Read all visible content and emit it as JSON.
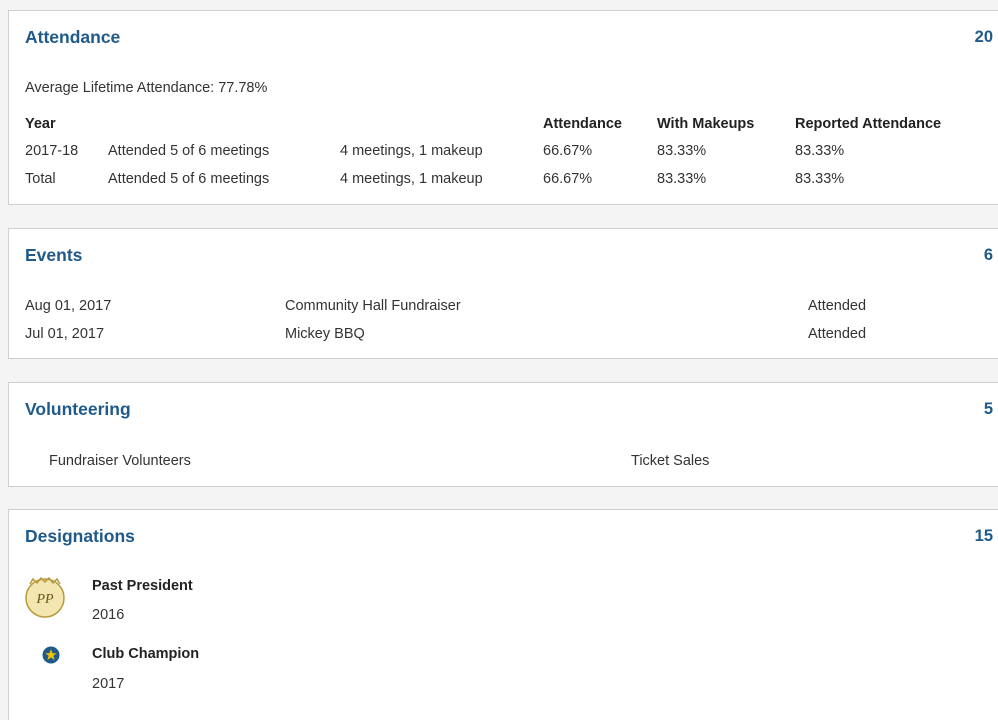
{
  "attendance": {
    "title": "Attendance",
    "count": "20",
    "average": "Average Lifetime Attendance: 77.78%",
    "headers": {
      "year": "Year",
      "attendance": "Attendance",
      "with_makeups": "With Makeups",
      "reported": "Reported Attendance"
    },
    "rows": [
      {
        "year": "2017-18",
        "attended": "Attended 5 of 6 meetings",
        "detail": "4 meetings, 1 makeup",
        "attendance": "66.67%",
        "with_makeups": "83.33%",
        "reported": "83.33%"
      },
      {
        "year": "Total",
        "attended": "Attended 5 of 6 meetings",
        "detail": "4 meetings, 1 makeup",
        "attendance": "66.67%",
        "with_makeups": "83.33%",
        "reported": "83.33%"
      }
    ]
  },
  "events": {
    "title": "Events",
    "count": "6",
    "rows": [
      {
        "date": "Aug 01, 2017",
        "name": "Community Hall Fundraiser",
        "status": "Attended"
      },
      {
        "date": "Jul 01, 2017",
        "name": "Mickey BBQ",
        "status": "Attended"
      }
    ]
  },
  "volunteering": {
    "title": "Volunteering",
    "count": "5",
    "rows": [
      {
        "group": "Fundraiser Volunteers",
        "role": "Ticket Sales"
      }
    ]
  },
  "designations": {
    "title": "Designations",
    "count": "15",
    "items": [
      {
        "name": "Past President",
        "year": "2016",
        "icon": "past-president-badge-icon",
        "badge_text": "PP"
      },
      {
        "name": "Club Champion",
        "year": "2017",
        "icon": "star-badge-icon"
      }
    ]
  },
  "colors": {
    "accent": "#1f5a8a",
    "badge_gold": "#f3e6b0",
    "star_blue": "#1f5a8a",
    "star_yellow": "#f2c200"
  }
}
